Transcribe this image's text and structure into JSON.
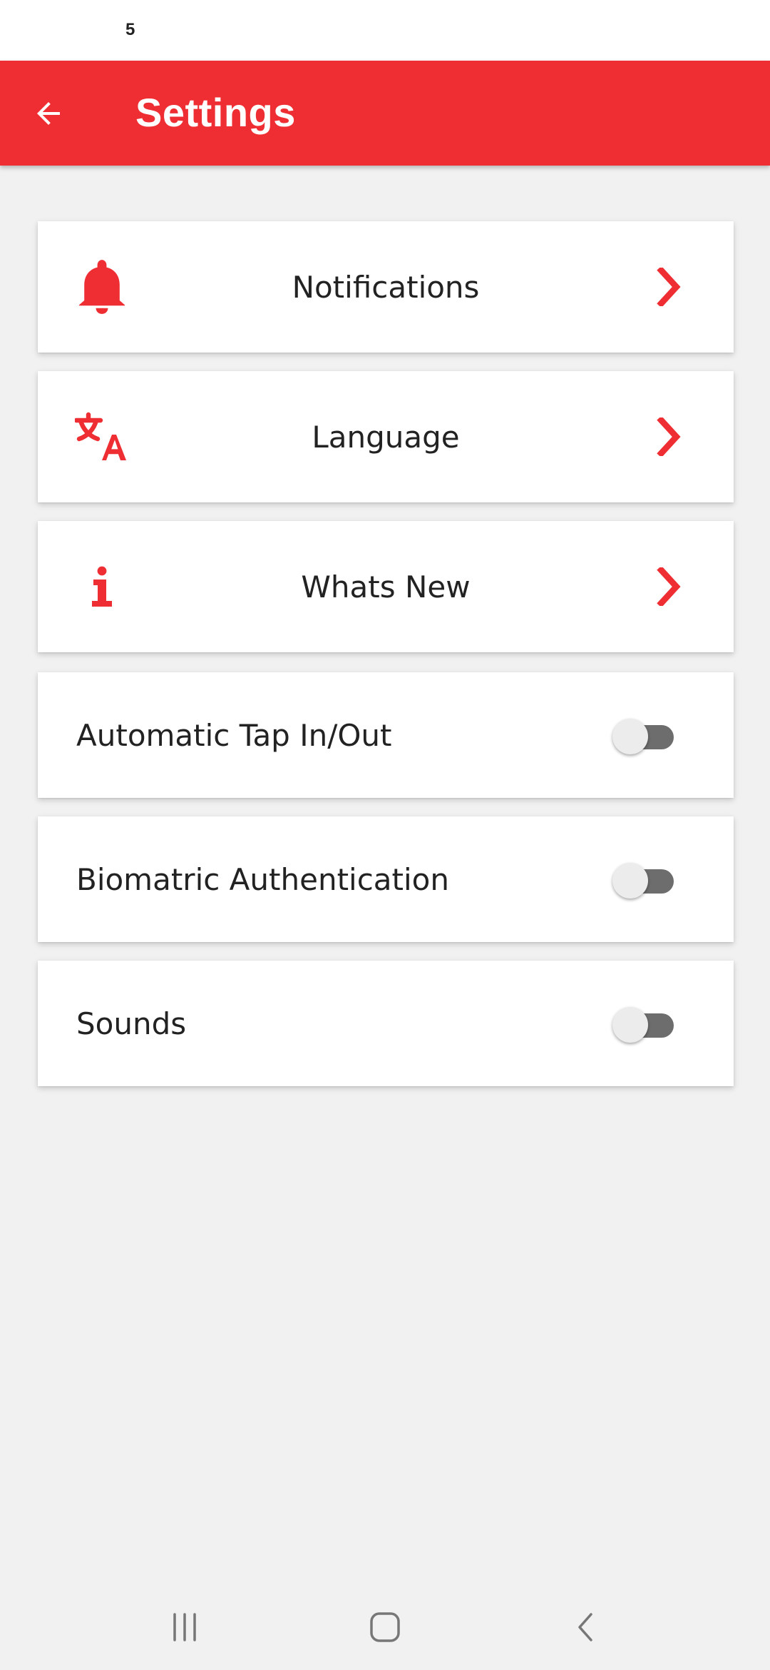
{
  "status_bar": {
    "time": "5"
  },
  "header": {
    "title": "Settings",
    "back_icon": "arrow-left-icon"
  },
  "colors": {
    "accent": "#ee2e32",
    "background": "#f1f1f1",
    "card": "#ffffff",
    "text": "#222222"
  },
  "nav_items": [
    {
      "label": "Notifications",
      "icon": "bell-icon"
    },
    {
      "label": "Language",
      "icon": "translate-icon"
    },
    {
      "label": "Whats New",
      "icon": "info-icon"
    }
  ],
  "toggles": [
    {
      "label": "Automatic Tap In/Out",
      "on": false
    },
    {
      "label": "Biomatric Authentication",
      "on": false
    },
    {
      "label": "Sounds",
      "on": false
    }
  ],
  "system_nav": [
    "recent-apps-icon",
    "home-icon",
    "back-icon"
  ]
}
